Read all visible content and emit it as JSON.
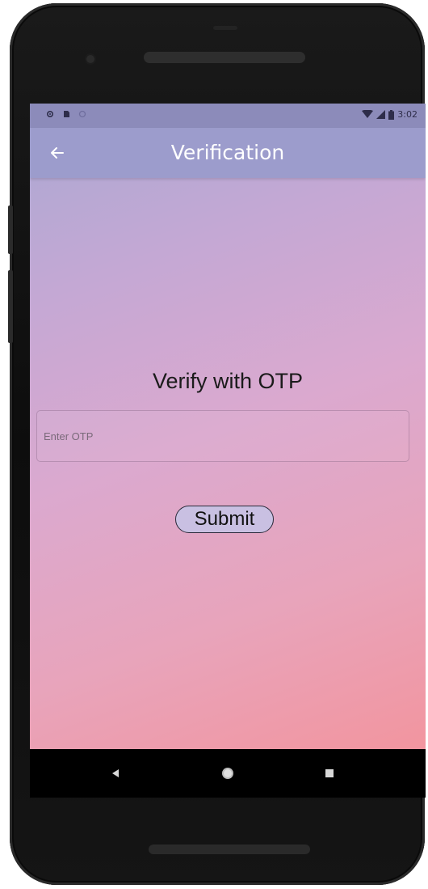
{
  "status_bar": {
    "left_icons": [
      "settings-icon",
      "sd-card-icon",
      "sync-icon"
    ],
    "right_icons": [
      "wifi-icon",
      "signal-icon",
      "battery-icon"
    ],
    "time": "3:02"
  },
  "app_bar": {
    "title": "Verification",
    "back_icon": "arrow-back-icon"
  },
  "content": {
    "heading": "Verify with OTP",
    "otp_placeholder": "Enter OTP",
    "otp_value": "",
    "submit_label": "Submit"
  },
  "nav_bar": {
    "icons": [
      "back-triangle-icon",
      "home-circle-icon",
      "recents-square-icon"
    ]
  },
  "colors": {
    "status_bar": "#8c8bba",
    "app_bar": "#9c9ccc",
    "gradient_start": "#a9a7d2",
    "gradient_end": "#f2959f",
    "button_fill": "#c9c0e2"
  }
}
